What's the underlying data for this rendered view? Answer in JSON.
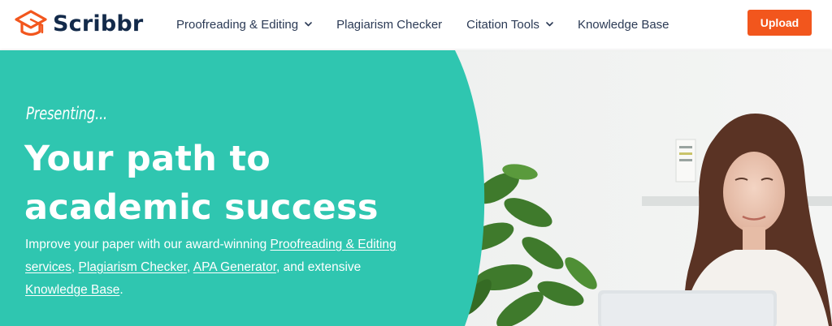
{
  "brand": {
    "name": "Scribbr",
    "colors": {
      "accent": "#f2561d",
      "teal": "#2fc6b0",
      "navy": "#132a4a"
    }
  },
  "nav": {
    "items": [
      {
        "label": "Proofreading & Editing",
        "has_dropdown": true
      },
      {
        "label": "Plagiarism Checker",
        "has_dropdown": false
      },
      {
        "label": "Citation Tools",
        "has_dropdown": true
      },
      {
        "label": "Knowledge Base",
        "has_dropdown": false
      }
    ]
  },
  "header": {
    "upload_label": "Upload"
  },
  "hero": {
    "eyebrow": "Presenting...",
    "headline_line1": "Your path to",
    "headline_line2": "academic success",
    "description": {
      "text_1": "Improve your paper with our award-winning ",
      "link_1": "Proofreading & Editing services",
      "text_2": ", ",
      "link_2": "Plagiarism Checker",
      "text_3": ", ",
      "link_3": "APA Generator",
      "text_4": ", and extensive ",
      "link_4": "Knowledge Base",
      "text_5": "."
    }
  },
  "icons": {
    "logo": "graduation-cap-logo-icon",
    "dropdown": "chevron-down-icon"
  }
}
